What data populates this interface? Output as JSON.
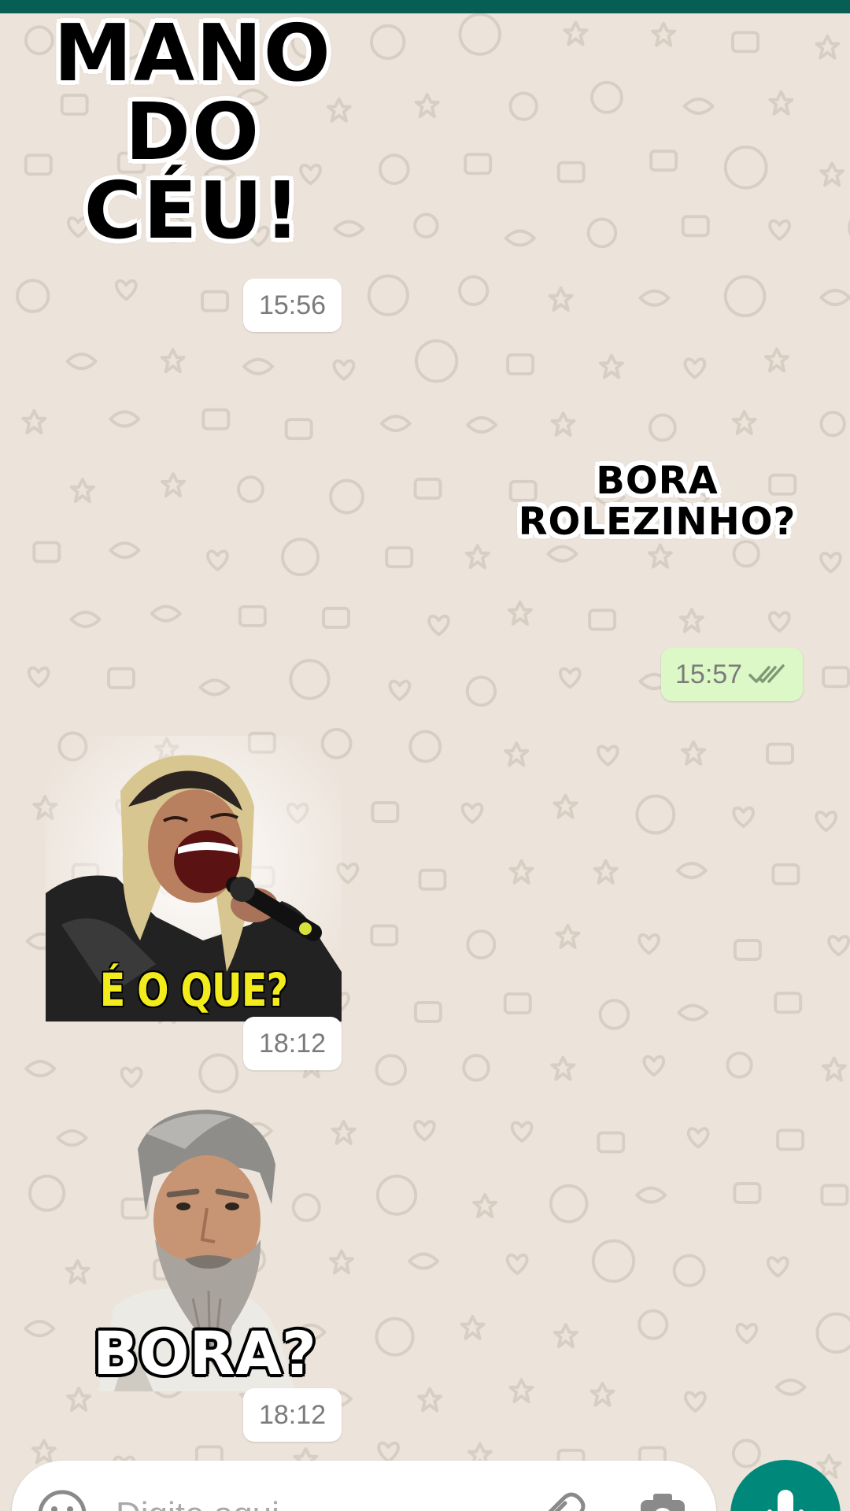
{
  "theme": {
    "header_color": "#075e54",
    "wallpaper_color": "#ece3da",
    "wallpaper_doodle_color": "#d8cfc4",
    "outgoing_bubble_color": "#dcf8c6",
    "incoming_bubble_color": "#ffffff",
    "timestamp_color": "#7b7b7b",
    "read_ticks_color": "#7c9a75",
    "send_button_color": "#00897b",
    "sticker_yellow": "#f3ec1c"
  },
  "messages": [
    {
      "direction": "incoming",
      "type": "sticker",
      "sticker_lines": [
        "MANO",
        "DO",
        "CÉU!"
      ],
      "time": "15:56"
    },
    {
      "direction": "outgoing",
      "type": "sticker",
      "sticker_lines": [
        "BORA",
        "ROLEZINHO?"
      ],
      "time": "15:57",
      "status": "read",
      "status_icon": "double-check-icon"
    },
    {
      "direction": "incoming",
      "type": "sticker",
      "caption": "É O QUE?",
      "time": "18:12"
    },
    {
      "direction": "incoming",
      "type": "sticker",
      "caption": "BORA?",
      "time": "18:12"
    }
  ],
  "composer": {
    "placeholder": "Digite aqui",
    "value": "",
    "emoji_icon": "emoji-icon",
    "attach_icon": "paperclip-icon",
    "camera_icon": "camera-icon",
    "send_icon": "microphone-icon"
  }
}
